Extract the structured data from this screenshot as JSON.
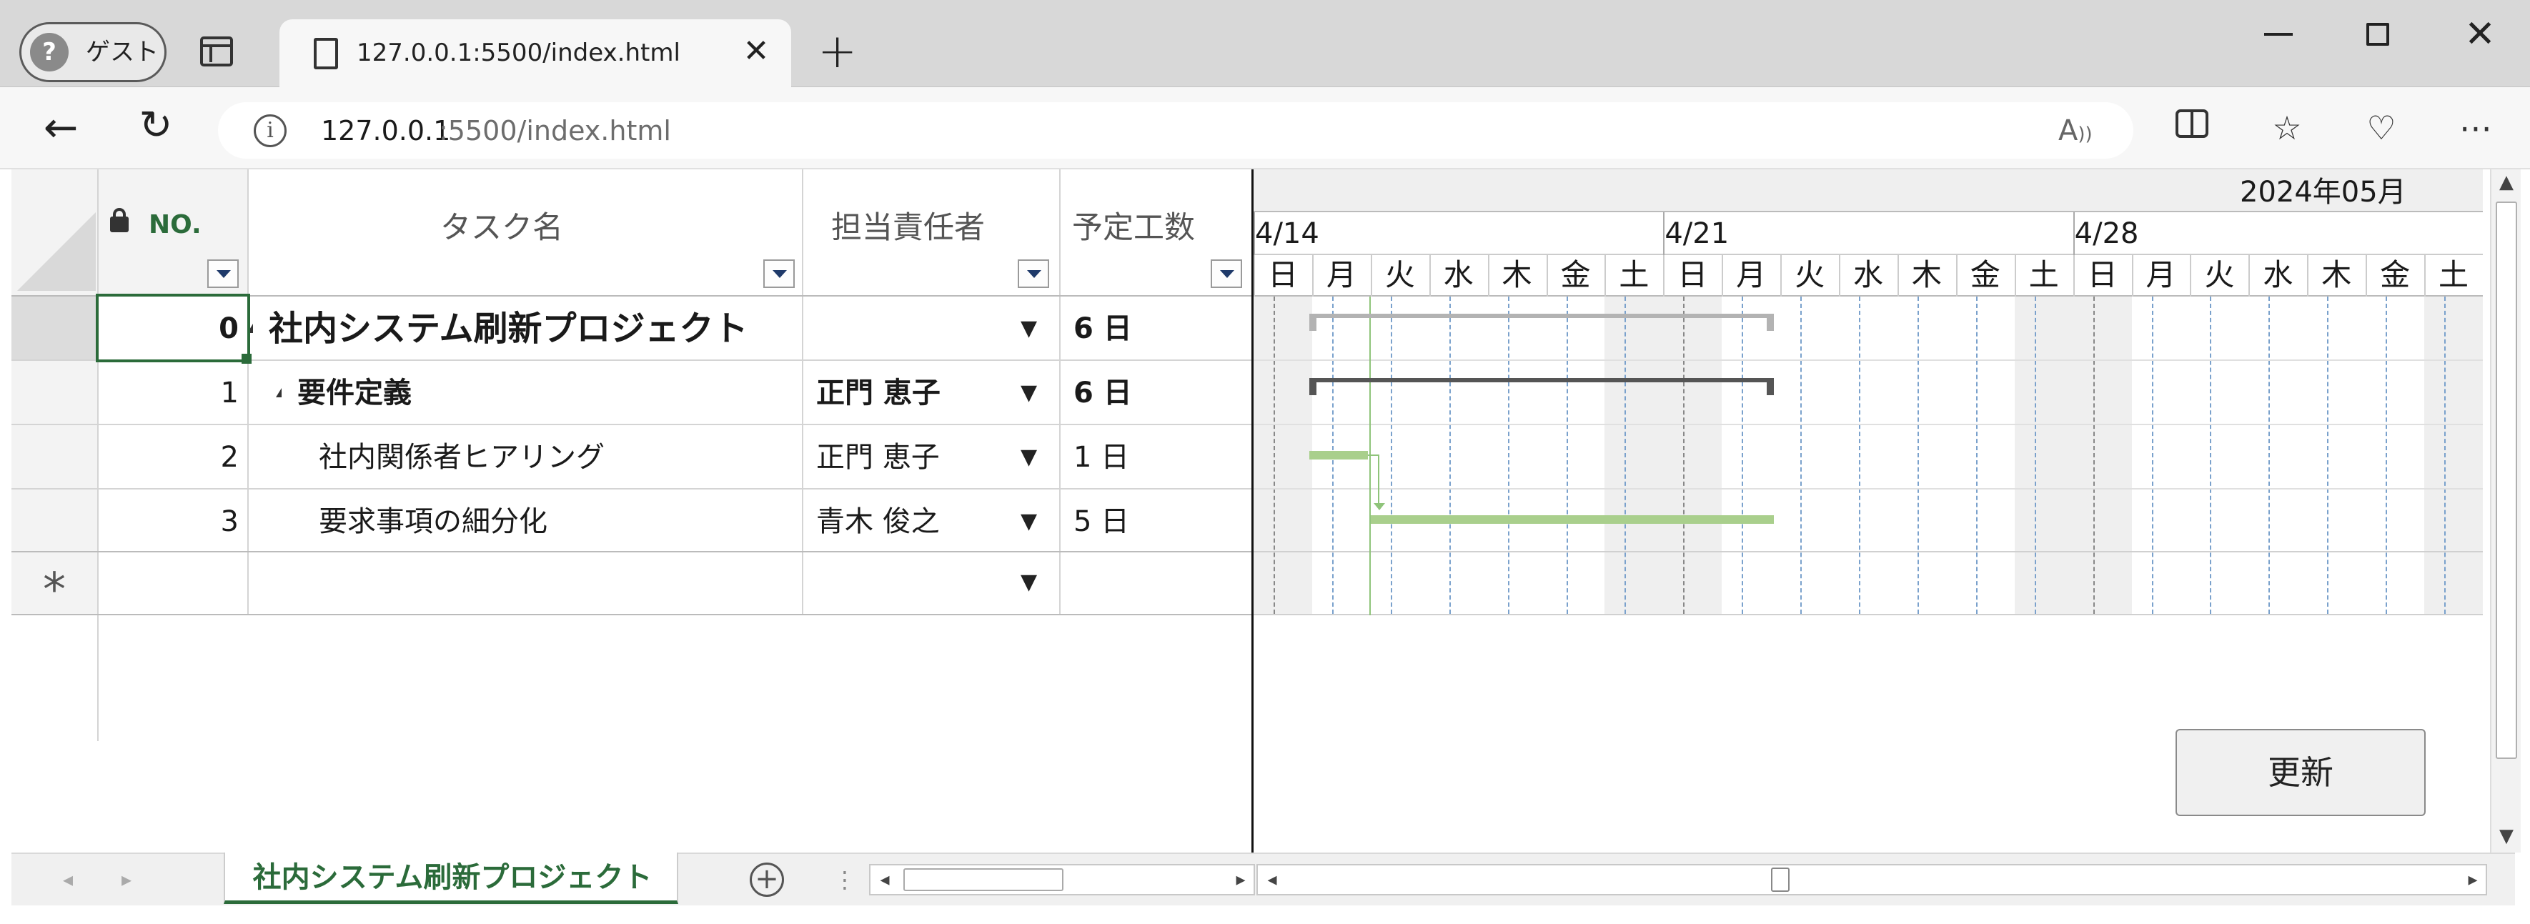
{
  "browser": {
    "guest_label": "ゲスト",
    "tab_title": "127.0.0.1:5500/index.html",
    "url_host": "127.0.0.1",
    "url_rest": ":5500/index.html"
  },
  "grid": {
    "columns": {
      "no": "NO.",
      "task_name": "タスク名",
      "assignee": "担当責任者",
      "effort": "予定工数"
    },
    "rows": [
      {
        "no": "0",
        "task": "社内システム刷新プロジェクト",
        "assignee": "",
        "effort": "6 日"
      },
      {
        "no": "1",
        "task": "要件定義",
        "assignee": "正門 恵子",
        "effort": "6 日"
      },
      {
        "no": "2",
        "task": "社内関係者ヒアリング",
        "assignee": "正門 恵子",
        "effort": "1 日"
      },
      {
        "no": "3",
        "task": "要求事項の細分化",
        "assignee": "青木 俊之",
        "effort": "5 日"
      }
    ],
    "new_row_marker": "*"
  },
  "gantt": {
    "month_label": "2024年05月",
    "weeks": [
      "4/14",
      "4/21",
      "4/28"
    ],
    "days": [
      "日",
      "月",
      "火",
      "水",
      "木",
      "金",
      "土",
      "日",
      "月",
      "火",
      "水",
      "木",
      "金",
      "土",
      "日",
      "月",
      "火",
      "水",
      "木",
      "金",
      "土"
    ],
    "bar_colors": {
      "summary": "#b3b3b3",
      "group": "#555555",
      "task": "#a9cf8c"
    }
  },
  "update_button": "更新",
  "sheet_tab": "社内システム刷新プロジェクト",
  "icons": [
    "question-icon",
    "tabs-icon",
    "doc-icon",
    "close-icon",
    "plus-icon",
    "back-icon",
    "reload-icon",
    "info-icon",
    "read-aloud-icon",
    "split-icon",
    "favorites-icon",
    "health-icon",
    "more-icon",
    "lock-icon",
    "filter-icon",
    "add-sheet-icon"
  ]
}
